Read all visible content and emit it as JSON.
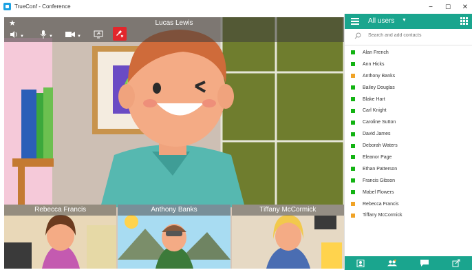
{
  "window": {
    "title": "TrueConf - Conference",
    "minimize": "−",
    "maximize": "☐",
    "close": "✕"
  },
  "video": {
    "speaker_name": "Lucas Lewis",
    "participants": [
      {
        "name": "Rebecca Francis"
      },
      {
        "name": "Anthony Banks"
      },
      {
        "name": "Tiffany McCormick"
      }
    ]
  },
  "panel": {
    "title": "All users",
    "search_placeholder": "Search and add contacts",
    "contacts": [
      {
        "name": "Alan French",
        "status": "online",
        "color": "#12b312"
      },
      {
        "name": "Ann Hicks",
        "status": "online",
        "color": "#12b312"
      },
      {
        "name": "Anthony Banks",
        "status": "busy",
        "color": "#f0a326"
      },
      {
        "name": "Bailey Douglas",
        "status": "online",
        "color": "#12b312"
      },
      {
        "name": "Blake Hart",
        "status": "online",
        "color": "#12b312"
      },
      {
        "name": "Carl Knight",
        "status": "online",
        "color": "#12b312"
      },
      {
        "name": "Caroline Sutton",
        "status": "online",
        "color": "#12b312"
      },
      {
        "name": "David James",
        "status": "online",
        "color": "#12b312"
      },
      {
        "name": "Deborah Waters",
        "status": "online",
        "color": "#12b312"
      },
      {
        "name": "Eleanor Page",
        "status": "online",
        "color": "#12b312"
      },
      {
        "name": "Ethan Patterson",
        "status": "online",
        "color": "#12b312"
      },
      {
        "name": "Francis Gibson",
        "status": "online",
        "color": "#12b312"
      },
      {
        "name": "Mabel Flowers",
        "status": "online",
        "color": "#12b312"
      },
      {
        "name": "Rebecca Francis",
        "status": "busy",
        "color": "#f0a326"
      },
      {
        "name": "Tiffany McCormick",
        "status": "busy",
        "color": "#f0a326"
      }
    ]
  },
  "colors": {
    "accent": "#1aa58e",
    "hangup": "#e3262c"
  }
}
